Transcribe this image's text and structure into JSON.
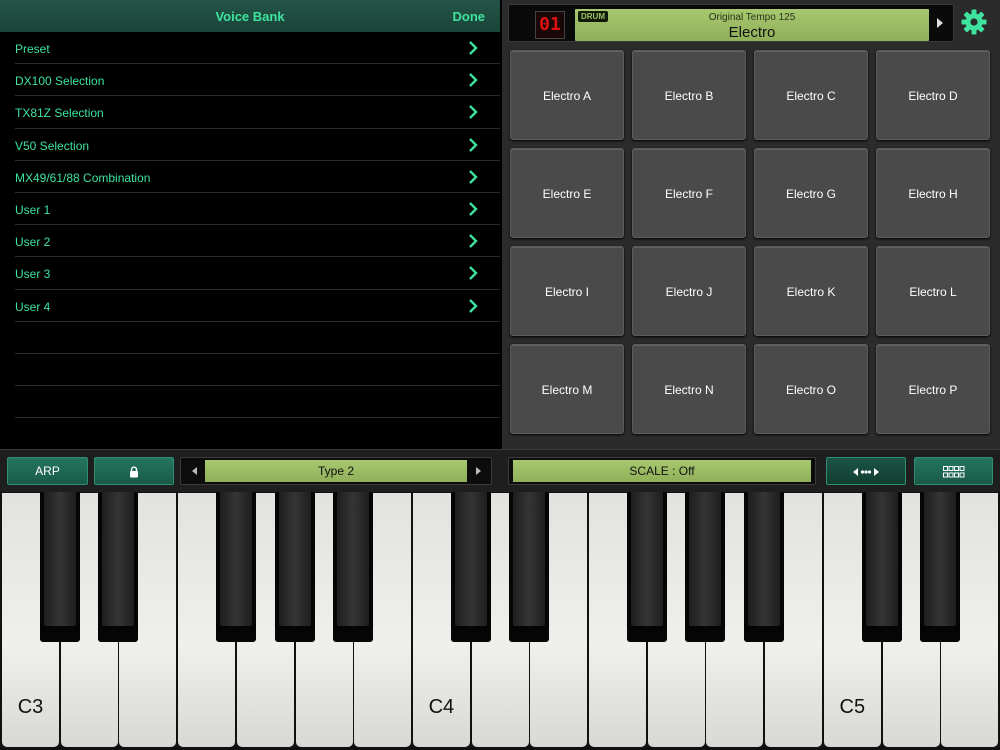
{
  "voice_bank": {
    "title": "Voice Bank",
    "done_label": "Done",
    "items": [
      {
        "label": "Preset"
      },
      {
        "label": "DX100 Selection"
      },
      {
        "label": "TX81Z Selection"
      },
      {
        "label": "V50 Selection"
      },
      {
        "label": "MX49/61/88 Combination"
      },
      {
        "label": "User 1"
      },
      {
        "label": "User 2"
      },
      {
        "label": "User 3"
      },
      {
        "label": "User 4"
      }
    ],
    "empty_rows": 4
  },
  "header": {
    "voice_number": "01",
    "badge": "DRUM",
    "subtitle": "Original Tempo 125",
    "voice_name": "Electro"
  },
  "pads": [
    "Electro A",
    "Electro B",
    "Electro C",
    "Electro D",
    "Electro E",
    "Electro F",
    "Electro G",
    "Electro H",
    "Electro I",
    "Electro J",
    "Electro K",
    "Electro L",
    "Electro M",
    "Electro N",
    "Electro O",
    "Electro P"
  ],
  "controls": {
    "arp_label": "ARP",
    "lock_icon": "lock-icon",
    "type_label": "Type 2",
    "scale_label": "SCALE : Off",
    "range_icon": "range-arrows-icon",
    "grid_icon": "pad-grid-icon"
  },
  "keyboard": {
    "labels": [
      "C3",
      "C4",
      "C5"
    ]
  },
  "colors": {
    "accent_green": "#3ee39f",
    "button_green": "#247560",
    "lcd_green": "#a8c870",
    "pad_gray": "#4a4a4a",
    "seg_red": "#dd1111"
  }
}
